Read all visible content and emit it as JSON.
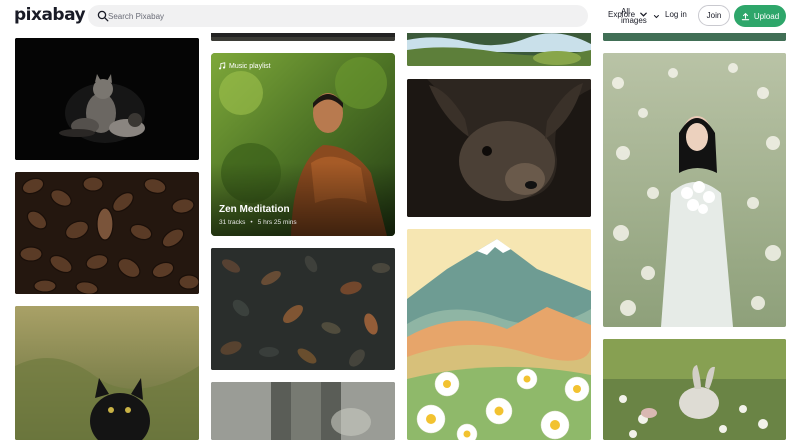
{
  "header": {
    "logo": "pixabay",
    "search": {
      "placeholder": "Search Pixabay",
      "scope": "All images"
    },
    "nav": {
      "explore": "Explore",
      "login": "Log in",
      "join": "Join",
      "upload": "Upload"
    }
  },
  "playlist": {
    "badge": "Music playlist",
    "title": "Zen Meditation",
    "tracks": "31 tracks",
    "separator": "•",
    "duration": "5 hrs 25 mins"
  },
  "tiles": [
    {
      "subject": "cats on black background"
    },
    {
      "subject": "coffee beans"
    },
    {
      "subject": "black cat in grass"
    },
    {
      "subject": "forest strip"
    },
    {
      "subject": "monk meditating"
    },
    {
      "subject": "autumn leaves"
    },
    {
      "subject": "tree trunk"
    },
    {
      "subject": "waterfall with moss"
    },
    {
      "subject": "deer close-up"
    },
    {
      "subject": "mountain with daisies illustration"
    },
    {
      "subject": "green strip"
    },
    {
      "subject": "woman in flower field"
    },
    {
      "subject": "bunny in flowers"
    }
  ],
  "colors": {
    "accent": "#2ea66a",
    "text": "#191b26"
  }
}
